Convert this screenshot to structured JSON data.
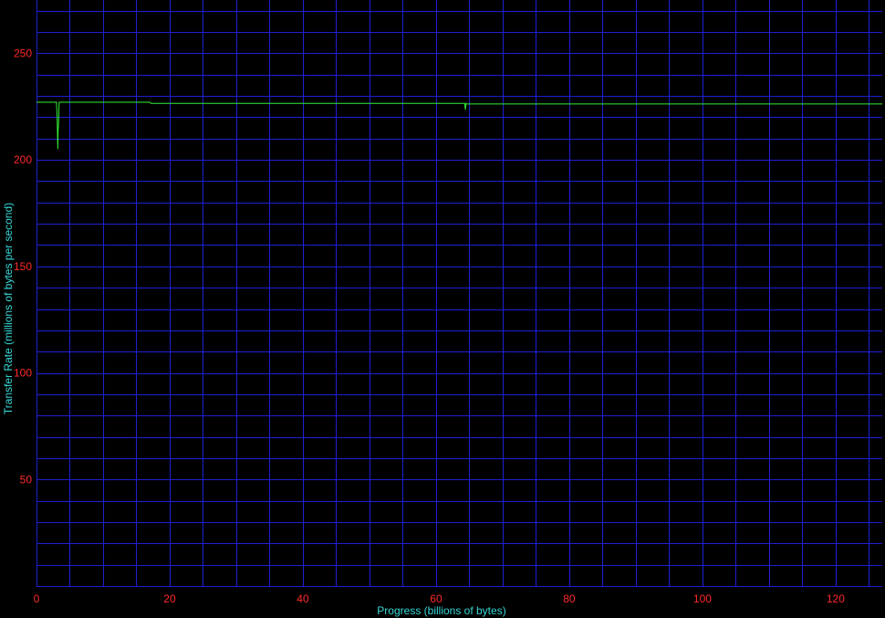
{
  "chart_data": {
    "type": "line",
    "title": "",
    "xlabel": "Progress (billions of bytes)",
    "ylabel": "Transfer Rate (millions of bytes per second)",
    "xlim": [
      0,
      127
    ],
    "ylim": [
      0,
      275
    ],
    "x_ticks": [
      0,
      20,
      40,
      60,
      80,
      100,
      120
    ],
    "x_tick_labels": [
      "0",
      "20",
      "40",
      "60",
      "80",
      "100",
      "120"
    ],
    "y_ticks": [
      50,
      100,
      150,
      200,
      250
    ],
    "y_tick_labels": [
      "50",
      "100",
      "150",
      "200",
      "250"
    ],
    "minor_grid_x_step": 5,
    "minor_grid_y_step": 10,
    "grid": true,
    "colors": {
      "background": "#000000",
      "grid": "#1f1fd6",
      "axis": "#1f1fd6",
      "tick_labels": "#ff2a2a",
      "axis_labels": "#37d7d7",
      "line": "#33ee33"
    },
    "series": [
      {
        "name": "",
        "x": [
          0,
          3.0,
          3.1,
          3.2,
          3.25,
          3.3,
          3.4,
          3.5,
          10,
          17.0,
          17.2,
          40,
          60,
          64.3,
          64.4,
          64.5,
          64.6,
          80,
          100,
          127
        ],
        "y": [
          227,
          227,
          220,
          205,
          214,
          216,
          227,
          227,
          227,
          227,
          226.5,
          226.5,
          226.5,
          226.5,
          223.5,
          226.5,
          226.2,
          226.2,
          226.2,
          226.2
        ]
      }
    ]
  }
}
